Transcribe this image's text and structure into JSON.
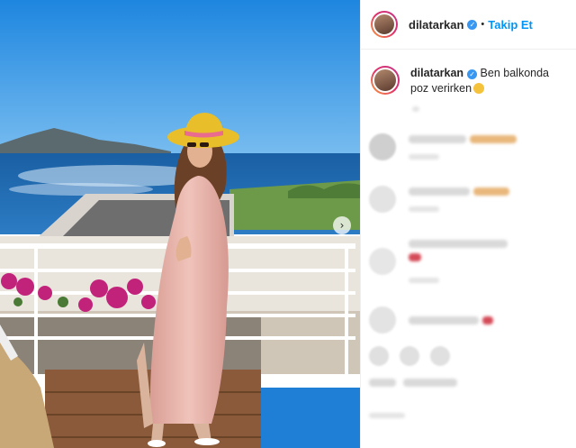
{
  "post": {
    "username": "dilatarkan",
    "verified": true,
    "follow_label": "Takip Et",
    "separator": "•",
    "caption_text": "Ben balkonda poz verirken",
    "caption_emoji": "smiling-face-emoji"
  },
  "carousel": {
    "next_glyph": "›"
  },
  "colors": {
    "accent": "#0095f6",
    "verified_badge": "#3897f0",
    "text": "#262626",
    "sky": "#2f8fd8",
    "sea": "#1f6fb5",
    "hat": "#e8bf2a",
    "dress": "#e8b7ae"
  },
  "comments": [
    {
      "author_blurred": true
    },
    {
      "author_blurred": true
    },
    {
      "author_blurred": true
    },
    {
      "author_blurred": true
    },
    {
      "author_blurred": true
    }
  ]
}
